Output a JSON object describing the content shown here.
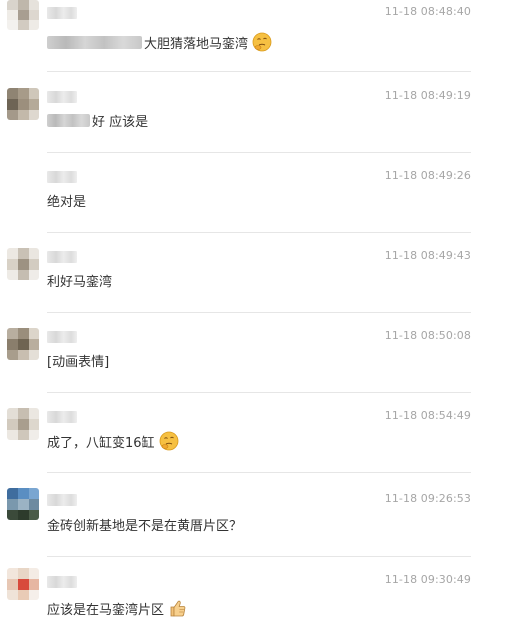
{
  "messages": [
    {
      "time": "11-18 08:48:40",
      "text": " 大胆猜落地马銮湾",
      "emoji": "thinking-emoji-icon"
    },
    {
      "time": "11-18 08:49:19",
      "text": "好 应该是",
      "emoji": null
    },
    {
      "time": "11-18 08:49:26",
      "text": "绝对是",
      "emoji": null
    },
    {
      "time": "11-18 08:49:43",
      "text": "利好马銮湾",
      "emoji": null
    },
    {
      "time": "11-18 08:50:08",
      "text": "[动画表情]",
      "emoji": null
    },
    {
      "time": "11-18 08:54:49",
      "text": "成了，八缸变16缸",
      "emoji": "thinking-emoji-icon"
    },
    {
      "time": "11-18 09:26:53",
      "text": "金砖创新基地是不是在黄厝片区？",
      "emoji": null
    },
    {
      "time": "11-18 09:30:49",
      "text": "应该是在马銮湾片区",
      "emoji": "thumbs-up-icon"
    }
  ],
  "colors": {
    "timestamp": "#a6a6a6",
    "message_text": "#333333",
    "divider": "#e6e6e6",
    "emoji_yellow": "#f6c042"
  }
}
